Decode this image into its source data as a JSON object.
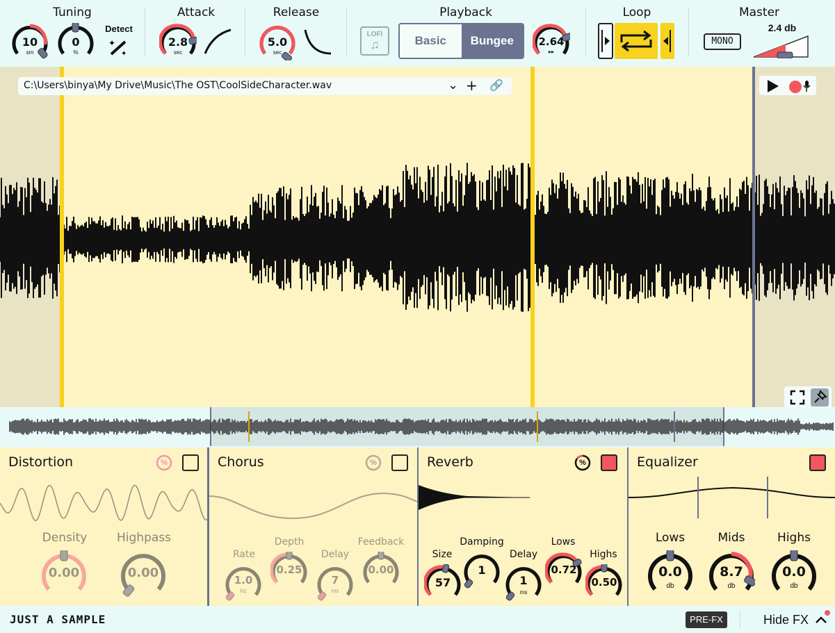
{
  "header": {
    "tuning": {
      "title": "Tuning",
      "semitones": "10",
      "semitones_unit": "sm",
      "cents": "0",
      "cents_unit": "%",
      "detect_label": "Detect"
    },
    "attack": {
      "title": "Attack",
      "value": "2.8",
      "unit": "sec"
    },
    "release": {
      "title": "Release",
      "value": "5.0",
      "unit": "sec"
    },
    "playback": {
      "title": "Playback",
      "lofi_label": "LOFI",
      "modes": [
        "Basic",
        "Bungee"
      ],
      "active_mode": "Bungee",
      "speed": "2.64",
      "speed_unit": "▸▸"
    },
    "loop": {
      "title": "Loop"
    },
    "master": {
      "title": "Master",
      "mono_label": "MONO",
      "gain": "2.4 db"
    }
  },
  "file": {
    "path": "C:\\Users\\binya\\My Drive\\Music\\The OST\\CoolSideCharacter.wav"
  },
  "effects": {
    "distortion": {
      "title": "Distortion",
      "pct": "%",
      "knobs": [
        {
          "label": "Density",
          "value": "0.00"
        },
        {
          "label": "Highpass",
          "value": "0.00"
        }
      ],
      "enabled": false
    },
    "chorus": {
      "title": "Chorus",
      "pct": "%",
      "knobs": [
        {
          "label": "Rate",
          "value": "1.0",
          "unit": "hz"
        },
        {
          "label": "Depth",
          "value": "0.25"
        },
        {
          "label": "Delay",
          "value": "7",
          "unit": "ms"
        },
        {
          "label": "Feedback",
          "value": "0.00"
        }
      ],
      "enabled": false
    },
    "reverb": {
      "title": "Reverb",
      "pct": "%",
      "knobs": [
        {
          "label": "Size",
          "value": "57"
        },
        {
          "label": "Damping",
          "value": "1"
        },
        {
          "label": "Delay",
          "value": "1",
          "unit": "ms"
        },
        {
          "label": "Lows",
          "value": "0.72"
        },
        {
          "label": "Highs",
          "value": "0.50"
        }
      ],
      "enabled": true
    },
    "equalizer": {
      "title": "Equalizer",
      "knobs": [
        {
          "label": "Lows",
          "value": "0.0",
          "unit": "db"
        },
        {
          "label": "Mids",
          "value": "8.7",
          "unit": "db"
        },
        {
          "label": "Highs",
          "value": "0.0",
          "unit": "db"
        }
      ],
      "enabled": true
    }
  },
  "footer": {
    "brand": "JUST A SAMPLE",
    "prefx_label": "PRE-FX",
    "hide_fx_label": "Hide FX"
  },
  "colors": {
    "accent_red": "#f2575c",
    "loop_yellow": "#f7d21e",
    "panel_yellow": "#fdf3c3",
    "bg_mint": "#e8faf8",
    "bungee_bg": "#6b7390"
  }
}
